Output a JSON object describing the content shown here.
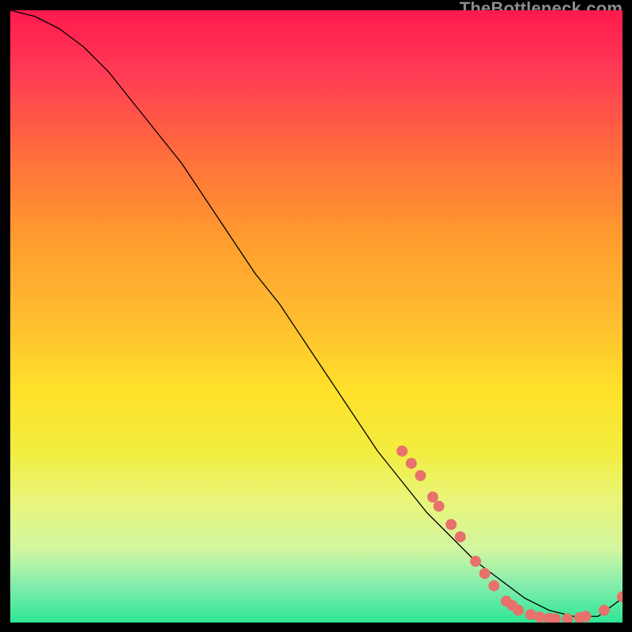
{
  "watermark": "TheBottleneck.com",
  "chart_data": {
    "type": "line",
    "title": "",
    "xlabel": "",
    "ylabel": "",
    "xlim": [
      0,
      100
    ],
    "ylim": [
      0,
      100
    ],
    "curve": {
      "x": [
        0,
        4,
        8,
        12,
        16,
        20,
        24,
        28,
        32,
        36,
        40,
        44,
        48,
        52,
        56,
        60,
        64,
        68,
        72,
        76,
        80,
        84,
        88,
        92,
        96,
        100
      ],
      "y": [
        100,
        99,
        97,
        94,
        90,
        85,
        80,
        75,
        69,
        63,
        57,
        52,
        46,
        40,
        34,
        28,
        23,
        18,
        14,
        10,
        7,
        4,
        2,
        1,
        1,
        4
      ]
    },
    "dot_series": {
      "name": "highlighted-points",
      "color": "#e8716b",
      "radius_pct": 0.9,
      "points": [
        {
          "x": 64.0,
          "y": 28.0
        },
        {
          "x": 65.5,
          "y": 26.0
        },
        {
          "x": 67.0,
          "y": 24.0
        },
        {
          "x": 69.0,
          "y": 20.5
        },
        {
          "x": 70.0,
          "y": 19.0
        },
        {
          "x": 72.0,
          "y": 16.0
        },
        {
          "x": 73.5,
          "y": 14.0
        },
        {
          "x": 76.0,
          "y": 10.0
        },
        {
          "x": 77.5,
          "y": 8.0
        },
        {
          "x": 79.0,
          "y": 6.0
        },
        {
          "x": 81.0,
          "y": 3.5
        },
        {
          "x": 82.0,
          "y": 2.8
        },
        {
          "x": 83.0,
          "y": 2.0
        },
        {
          "x": 85.0,
          "y": 1.3
        },
        {
          "x": 86.5,
          "y": 0.9
        },
        {
          "x": 88.0,
          "y": 0.7
        },
        {
          "x": 89.0,
          "y": 0.6
        },
        {
          "x": 91.0,
          "y": 0.6
        },
        {
          "x": 93.0,
          "y": 0.8
        },
        {
          "x": 94.0,
          "y": 1.0
        },
        {
          "x": 97.0,
          "y": 2.0
        },
        {
          "x": 100.0,
          "y": 4.2
        }
      ]
    }
  }
}
